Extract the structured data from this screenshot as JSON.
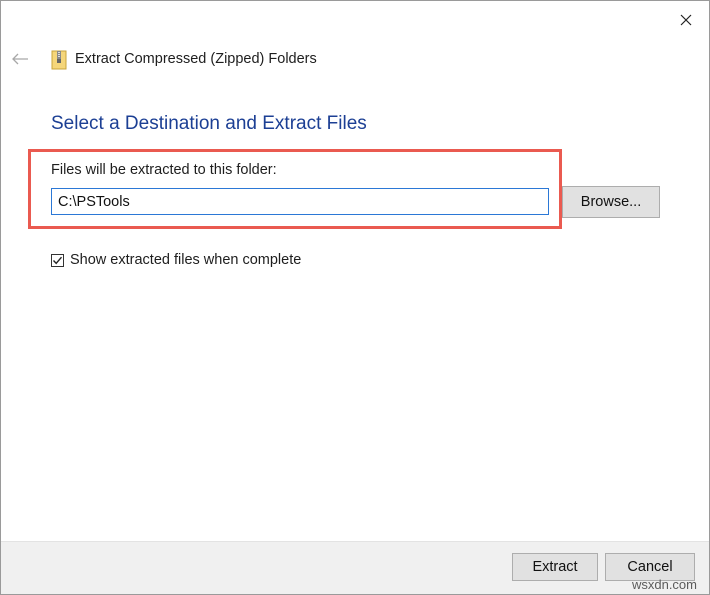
{
  "window": {
    "title": "Extract Compressed (Zipped) Folders",
    "icons": {
      "back": "back-arrow-icon",
      "close": "close-icon",
      "zip": "zip-folder-icon"
    }
  },
  "main": {
    "heading": "Select a Destination and Extract Files",
    "folder_label": "Files will be extracted to this folder:",
    "destination_value": "C:\\PSTools",
    "browse_label": "Browse...",
    "show_files_label": "Show extracted files when complete",
    "show_files_checked": true
  },
  "footer": {
    "extract_label": "Extract",
    "cancel_label": "Cancel"
  },
  "watermark": "wsxdn.com",
  "colors": {
    "heading": "#1c3f94",
    "highlight": "#ea5a50",
    "input_border": "#2b78d6"
  }
}
